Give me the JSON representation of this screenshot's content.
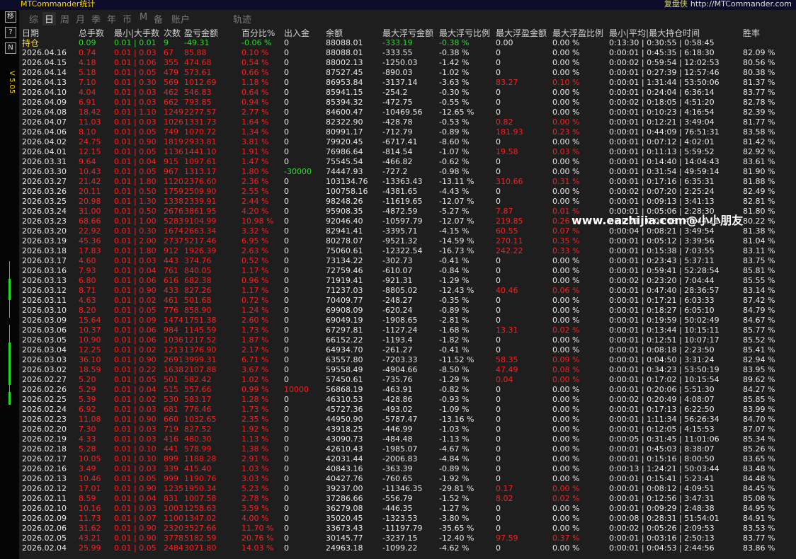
{
  "app": {
    "title": "MTCommander统计",
    "brand": "复盘侠",
    "brand_url": "http://MTCommander.com",
    "version": "V 5.05",
    "sidebar_buttons": [
      "移",
      "?",
      "N"
    ]
  },
  "tabs": [
    "综",
    "日",
    "周",
    "月",
    "季",
    "年",
    "币",
    "M",
    "备",
    "账户",
    "轨迹"
  ],
  "active_tab": "日",
  "columns": [
    "日期",
    "总手数",
    "最小|大手数",
    "次数",
    "盈亏金额",
    "百分比%",
    "出入金",
    "余额",
    "最大浮亏金额",
    "最大浮亏比例",
    "最大浮盈金额",
    "最大浮盈比例",
    "最小|平均|最大持仓时间",
    "胜率"
  ],
  "summary": {
    "label": "持仓",
    "lots": "0.09",
    "minmax": "0.01 | 0.01",
    "count": "9",
    "pnl": "-49.31",
    "pct": "-0.06 %",
    "io": "0",
    "balance": "88088.01",
    "dd_amt": "-333.19",
    "dd_pct": "-0.38 %",
    "fp_amt": "0.00",
    "fp_pct": "0.00 %",
    "hold": "0:13:30 | 0:30:55 | 0:58:45",
    "win": ""
  },
  "rows": [
    [
      "2026.04.16",
      "0.74",
      "0.01 | 0.03",
      "67",
      "85.88",
      "0.10 %",
      "0",
      "88088.01",
      "-333.55",
      "-0.38 %",
      "0",
      "0.00 %",
      "0:00:01 | 0:45:35 | 6:18:30",
      "82.09 %"
    ],
    [
      "2026.04.15",
      "4.18",
      "0.01 | 0.06",
      "355",
      "474.68",
      "0.54 %",
      "0",
      "88002.13",
      "-1250.03",
      "-1.42 %",
      "0",
      "0.00 %",
      "0:00:02 | 0:59:54 | 12:02:53",
      "80.56 %"
    ],
    [
      "2026.04.14",
      "5.18",
      "0.01 | 0.05",
      "479",
      "573.61",
      "0.66 %",
      "0",
      "87527.45",
      "-890.03",
      "-1.02 %",
      "0",
      "0.00 %",
      "0:00:01 | 0:27:39 | 12:57:46",
      "80.38 %"
    ],
    [
      "2026.04.13",
      "7.10",
      "0.01 | 0.30",
      "569",
      "1012.69",
      "1.18 %",
      "0",
      "86953.84",
      "-3137.14",
      "-3.63 %",
      "83.27",
      "0.10 %",
      "0:00:01 | 1:31:44 | 53:50:06",
      "81.37 %"
    ],
    [
      "2026.04.10",
      "4.04",
      "0.01 | 0.03",
      "462",
      "546.83",
      "0.64 %",
      "0",
      "85941.15",
      "-254.2",
      "-0.30 %",
      "0",
      "0.00 %",
      "0:00:01 | 0:24:04 | 6:36:14",
      "83.77 %"
    ],
    [
      "2026.04.09",
      "6.91",
      "0.01 | 0.03",
      "662",
      "793.85",
      "0.94 %",
      "0",
      "85394.32",
      "-472.75",
      "-0.55 %",
      "0",
      "0.00 %",
      "0:00:02 | 0:18:05 | 4:51:20",
      "82.78 %"
    ],
    [
      "2026.04.08",
      "18.42",
      "0.01 | 1.10",
      "1249",
      "2277.57",
      "2.77 %",
      "0",
      "84600.47",
      "-10469.56",
      "-12.65 %",
      "0",
      "0.00 %",
      "0:00:01 | 0:10:23 | 4:16:54",
      "82.39 %"
    ],
    [
      "2026.04.07",
      "11.03",
      "0.01 | 0.03",
      "1026",
      "1331.73",
      "1.64 %",
      "0",
      "82322.90",
      "-428.78",
      "-0.53 %",
      "0.82",
      "0.00 %",
      "0:00:01 | 0:12:21 | 3:49:04",
      "81.77 %"
    ],
    [
      "2026.04.06",
      "8.10",
      "0.01 | 0.05",
      "749",
      "1070.72",
      "1.34 %",
      "0",
      "80991.17",
      "-712.79",
      "-0.89 %",
      "181.93",
      "0.23 %",
      "0:00:01 | 0:44:09 | 76:51:31",
      "83.58 %"
    ],
    [
      "2026.04.02",
      "24.75",
      "0.01 | 0.90",
      "1819",
      "2933.81",
      "3.81 %",
      "0",
      "79920.45",
      "-6717.41",
      "-8.60 %",
      "0",
      "0.00 %",
      "0:00:01 | 0:07:12 | 4:02:01",
      "81.42 %"
    ],
    [
      "2026.04.01",
      "12.15",
      "0.01 | 0.05",
      "1136",
      "1441.10",
      "1.91 %",
      "0",
      "76986.64",
      "-814.54",
      "-1.07 %",
      "19.58",
      "0.03 %",
      "0:00:01 | 0:11:13 | 5:59:52",
      "82.92 %"
    ],
    [
      "2026.03.31",
      "9.64",
      "0.01 | 0.04",
      "915",
      "1097.61",
      "1.47 %",
      "0",
      "75545.54",
      "-466.82",
      "-0.62 %",
      "0",
      "0.00 %",
      "0:00:01 | 0:14:40 | 14:04:43",
      "83.61 %"
    ],
    [
      "2026.03.30",
      "10.43",
      "0.01 | 0.05",
      "967",
      "1313.17",
      "1.80 %",
      "-30000",
      "74447.93",
      "-727.2",
      "-0.98 %",
      "0",
      "0.00 %",
      "0:00:01 | 0:31:54 | 49:59:14",
      "81.90 %"
    ],
    [
      "2026.03.27",
      "21.42",
      "0.01 | 1.80",
      "1120",
      "2376.60",
      "2.36 %",
      "0",
      "103134.76",
      "-13363.43",
      "-13.11 %",
      "310.66",
      "0.31 %",
      "0:00:01 | 0:17:16 | 6:35:31",
      "81.88 %"
    ],
    [
      "2026.03.26",
      "20.11",
      "0.01 | 0.50",
      "1759",
      "2509.90",
      "2.55 %",
      "0",
      "100758.16",
      "-4381.65",
      "-4.43 %",
      "0",
      "0.00 %",
      "0:00:02 | 0:07:20 | 2:25:24",
      "82.49 %"
    ],
    [
      "2026.03.25",
      "20.98",
      "0.01 | 1.30",
      "1338",
      "2339.91",
      "2.44 %",
      "0",
      "98248.26",
      "-11619.65",
      "-12.07 %",
      "0",
      "0.00 %",
      "0:00:01 | 0:09:13 | 3:41:13",
      "82.81 %"
    ],
    [
      "2026.03.24",
      "31.00",
      "0.01 | 0.50",
      "2676",
      "3861.95",
      "4.20 %",
      "0",
      "95908.35",
      "-4872.59",
      "-5.27 %",
      "7.87",
      "0.01 %",
      "0:00:01 | 0:05:06 | 2:28:30",
      "81.80 %"
    ],
    [
      "2026.03.23",
      "68.66",
      "0.01 | 1.00",
      "5283",
      "9104.99",
      "10.98 %",
      "0",
      "92046.40",
      "-10597.79",
      "-12.07 %",
      "219.85",
      "0.26 %",
      "0:00:01 | 0:06:08 | 49:44:11",
      "80.22 %"
    ],
    [
      "2026.03.20",
      "22.92",
      "0.01 | 0.30",
      "1674",
      "2663.34",
      "3.32 %",
      "0",
      "82941.41",
      "-3395.71",
      "-4.15 %",
      "60.55",
      "0.07 %",
      "0:00:04 | 0:08:21 | 3:49:54",
      "81.38 %"
    ],
    [
      "2026.03.19",
      "45.36",
      "0.01 | 2.00",
      "2737",
      "5217.46",
      "6.95 %",
      "0",
      "80278.07",
      "-9521.32",
      "-14.59 %",
      "270.11",
      "0.35 %",
      "0:00:01 | 0:05:12 | 3:39:56",
      "81.04 %"
    ],
    [
      "2026.03.18",
      "17.83",
      "0.01 | 1.80",
      "912",
      "1926.39",
      "2.63 %",
      "0",
      "75060.61",
      "-12322.54",
      "-16.73 %",
      "242.22",
      "0.33 %",
      "0:00:01 | 0:15:38 | 7:03:55",
      "83.11 %"
    ],
    [
      "2026.03.17",
      "4.60",
      "0.01 | 0.03",
      "443",
      "374.76",
      "0.52 %",
      "0",
      "73134.22",
      "-302.73",
      "-0.41 %",
      "0",
      "0.00 %",
      "0:00:01 | 0:23:43 | 5:37:11",
      "83.75 %"
    ],
    [
      "2026.03.16",
      "7.93",
      "0.01 | 0.04",
      "761",
      "840.05",
      "1.17 %",
      "0",
      "72759.46",
      "-610.07",
      "-0.84 %",
      "0",
      "0.00 %",
      "0:00:01 | 0:59:41 | 52:28:54",
      "85.81 %"
    ],
    [
      "2026.03.13",
      "6.80",
      "0.01 | 0.06",
      "616",
      "682.38",
      "0.96 %",
      "0",
      "71919.41",
      "-921.31",
      "-1.29 %",
      "0",
      "0.00 %",
      "0:00:02 | 0:23:20 | 7:04:44",
      "85.55 %"
    ],
    [
      "2026.03.12",
      "8.71",
      "0.01 | 0.90",
      "433",
      "827.26",
      "1.17 %",
      "0",
      "71237.03",
      "-8805.02",
      "-12.43 %",
      "40.46",
      "0.06 %",
      "0:00:01 | 0:47:40 | 28:36:57",
      "83.14 %"
    ],
    [
      "2026.03.11",
      "4.63",
      "0.01 | 0.02",
      "461",
      "501.68",
      "0.72 %",
      "0",
      "70409.77",
      "-248.27",
      "-0.35 %",
      "0",
      "0.00 %",
      "0:00:01 | 0:17:21 | 6:03:33",
      "87.42 %"
    ],
    [
      "2026.03.10",
      "8.20",
      "0.01 | 0.05",
      "776",
      "858.90",
      "1.24 %",
      "0",
      "69908.09",
      "-620.24",
      "-0.89 %",
      "0",
      "0.00 %",
      "0:00:01 | 0:18:27 | 6:05:10",
      "84.79 %"
    ],
    [
      "2026.03.09",
      "15.64",
      "0.01 | 0.09",
      "1474",
      "1751.38",
      "2.60 %",
      "0",
      "69049.19",
      "-1908.65",
      "-2.81 %",
      "0",
      "0.00 %",
      "0:00:01 | 0:19:59 | 50:02:49",
      "84.67 %"
    ],
    [
      "2026.03.06",
      "10.37",
      "0.01 | 0.06",
      "984",
      "1145.59",
      "1.73 %",
      "0",
      "67297.81",
      "-1127.24",
      "-1.68 %",
      "13.31",
      "0.02 %",
      "0:00:01 | 0:13:44 | 10:15:11",
      "85.77 %"
    ],
    [
      "2026.03.05",
      "10.90",
      "0.01 | 0.06",
      "1036",
      "1217.52",
      "1.87 %",
      "0",
      "66152.22",
      "-1193.4",
      "-1.82 %",
      "0",
      "0.00 %",
      "0:00:01 | 0:12:51 | 10:07:17",
      "85.52 %"
    ],
    [
      "2026.03.04",
      "12.25",
      "0.01 | 0.02",
      "1213",
      "1376.90",
      "2.17 %",
      "0",
      "64934.70",
      "-261.27",
      "-0.41 %",
      "0",
      "0.00 %",
      "0:00:01 | 0:08:18 | 2:23:50",
      "85.41 %"
    ],
    [
      "2026.03.03",
      "36.10",
      "0.01 | 0.90",
      "2691",
      "3999.31",
      "6.71 %",
      "0",
      "63557.80",
      "-7203.33",
      "-11.52 %",
      "58.35",
      "0.09 %",
      "0:00:01 | 0:04:50 | 3:31:24",
      "82.94 %"
    ],
    [
      "2026.03.02",
      "18.59",
      "0.01 | 0.22",
      "1638",
      "2107.88",
      "3.67 %",
      "0",
      "59558.49",
      "-4904.66",
      "-8.50 %",
      "47.49",
      "0.08 %",
      "0:00:01 | 0:34:23 | 53:50:19",
      "83.95 %"
    ],
    [
      "2026.02.27",
      "5.20",
      "0.01 | 0.05",
      "501",
      "582.42",
      "1.02 %",
      "0",
      "57450.61",
      "-735.76",
      "-1.29 %",
      "0.04",
      "0.00 %",
      "0:00:01 | 0:17:02 | 10:15:54",
      "89.62 %"
    ],
    [
      "2026.02.26",
      "5.29",
      "0.01 | 0.04",
      "515",
      "557.66",
      "0.99 %",
      "10000",
      "56868.19",
      "-463.91",
      "-0.82 %",
      "0",
      "0.00 %",
      "0:00:01 | 0:20:06 | 5:51:30",
      "84.27 %"
    ],
    [
      "2026.02.25",
      "5.39",
      "0.01 | 0.02",
      "530",
      "583.17",
      "1.28 %",
      "0",
      "46310.53",
      "-428.86",
      "-0.93 %",
      "0",
      "0.00 %",
      "0:00:02 | 0:20:49 | 4:08:07",
      "85.85 %"
    ],
    [
      "2026.02.24",
      "6.92",
      "0.01 | 0.03",
      "681",
      "776.46",
      "1.73 %",
      "0",
      "45727.36",
      "-493.02",
      "-1.09 %",
      "0",
      "0.00 %",
      "0:00:01 | 0:17:13 | 6:22:50",
      "83.99 %"
    ],
    [
      "2026.02.23",
      "11.08",
      "0.01 | 0.90",
      "660",
      "1032.65",
      "2.35 %",
      "0",
      "44950.90",
      "-5787.47",
      "-13.16 %",
      "0",
      "0.00 %",
      "0:00:01 | 1:11:34 | 56:26:34",
      "84.70 %"
    ],
    [
      "2026.02.20",
      "7.30",
      "0.01 | 0.03",
      "719",
      "827.52",
      "1.92 %",
      "0",
      "43918.25",
      "-446.99",
      "-1.03 %",
      "0",
      "0.00 %",
      "0:00:01 | 0:12:05 | 4:15:53",
      "87.07 %"
    ],
    [
      "2026.02.19",
      "4.33",
      "0.01 | 0.03",
      "416",
      "480.30",
      "1.13 %",
      "0",
      "43090.73",
      "-484.48",
      "-1.13 %",
      "0",
      "0.00 %",
      "0:00:05 | 0:31:45 | 11:01:06",
      "85.34 %"
    ],
    [
      "2026.02.18",
      "5.28",
      "0.01 | 0.10",
      "441",
      "578.99",
      "1.38 %",
      "0",
      "42610.43",
      "-1985.07",
      "-4.67 %",
      "0",
      "0.00 %",
      "0:00:01 | 0:45:03 | 8:38:07",
      "85.26 %"
    ],
    [
      "2026.02.17",
      "10.05",
      "0.01 | 0.10",
      "899",
      "1188.28",
      "2.91 %",
      "0",
      "42031.44",
      "-2006.83",
      "-4.84 %",
      "0",
      "0.00 %",
      "0:00:01 | 0:15:16 | 8:00:50",
      "83.65 %"
    ],
    [
      "2026.02.16",
      "3.49",
      "0.01 | 0.03",
      "339",
      "415.40",
      "1.03 %",
      "0",
      "40843.16",
      "-363.39",
      "-0.89 %",
      "0",
      "0.00 %",
      "0:00:13 | 1:24:21 | 50:03:44",
      "83.48 %"
    ],
    [
      "2026.02.13",
      "10.46",
      "0.01 | 0.05",
      "999",
      "1190.76",
      "3.03 %",
      "0",
      "40427.76",
      "-760.65",
      "-1.92 %",
      "0",
      "0.00 %",
      "0:00:01 | 0:15:41 | 5:23:41",
      "84.48 %"
    ],
    [
      "2026.02.12",
      "17.01",
      "0.01 | 0.90",
      "1235",
      "1950.34",
      "5.23 %",
      "0",
      "39237.00",
      "-11346.35",
      "-29.81 %",
      "0.17",
      "0.00 %",
      "0:00:01 | 0:08:12 | 4:09:51",
      "84.45 %"
    ],
    [
      "2026.02.11",
      "8.59",
      "0.01 | 0.04",
      "831",
      "1007.58",
      "2.78 %",
      "0",
      "37286.66",
      "-556.79",
      "-1.52 %",
      "8.02",
      "0.02 %",
      "0:00:01 | 0:12:56 | 3:47:31",
      "85.08 %"
    ],
    [
      "2026.02.10",
      "10.16",
      "0.01 | 0.03",
      "1003",
      "1258.63",
      "3.59 %",
      "0",
      "36279.08",
      "-446.35",
      "-1.27 %",
      "0",
      "0.00 %",
      "0:00:01 | 0:09:29 | 2:48:38",
      "84.95 %"
    ],
    [
      "2026.02.09",
      "11.73",
      "0.01 | 0.07",
      "1100",
      "1347.02",
      "4.00 %",
      "0",
      "35020.45",
      "-1323.53",
      "-3.80 %",
      "0",
      "0.00 %",
      "0:00:08 | 0:28:31 | 51:54:01",
      "84.91 %"
    ],
    [
      "2026.02.06",
      "31.62",
      "0.01 | 0.90",
      "2320",
      "3527.66",
      "11.70 %",
      "0",
      "33673.43",
      "-11197.79",
      "-35.65 %",
      "0",
      "0.00 %",
      "0:00:02 | 0:05:26 | 2:09:53",
      "83.53 %"
    ],
    [
      "2026.02.05",
      "43.21",
      "0.01 | 0.90",
      "3778",
      "5182.59",
      "20.76 %",
      "0",
      "30145.77",
      "-3237.15",
      "-12.40 %",
      "97.59",
      "0.37 %",
      "0:00:01 | 0:03:16 | 2:50:13",
      "83.77 %"
    ],
    [
      "2026.02.04",
      "25.99",
      "0.01 | 0.05",
      "2484",
      "3071.80",
      "14.03 %",
      "0",
      "24963.18",
      "-1099.22",
      "-4.62 %",
      "0",
      "0.00 %",
      "0:00:01 | 0:04:53 | 2:44:56",
      "83.86 %"
    ]
  ],
  "watermark": "www.eazhijia.com@小小朋友",
  "colors": {
    "profit": "#ff1e1e",
    "neutral": "#e8e8e8",
    "summary": "#2ddc2d",
    "background": "#1e1e1e"
  }
}
